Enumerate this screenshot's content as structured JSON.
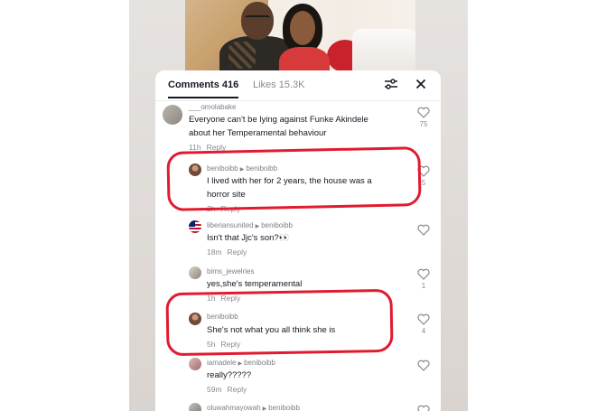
{
  "tabs": {
    "comments_label": "Comments 416",
    "likes_label": "Likes 15.3K"
  },
  "comments": [
    {
      "username": "___omolabake",
      "text_lines": [
        "Everyone can't be lying against Funke Akindele",
        "about her Temperamental behaviour"
      ],
      "time": "11h",
      "reply_label": "Reply",
      "likes": "75"
    },
    {
      "username": "beniboibb",
      "reply_to": "beniboibb",
      "text_lines": [
        "I lived with her for 2 years, the house was a",
        "horror site"
      ],
      "time": "2h",
      "reply_label": "Reply",
      "likes": "5"
    },
    {
      "username": "liberiansunited",
      "reply_to": "beniboibb",
      "text_lines": [
        "Isn't that Jjc's son?👀"
      ],
      "time": "18m",
      "reply_label": "Reply",
      "likes": ""
    },
    {
      "username": "bims_jewelries",
      "text_lines": [
        "yes,she's temperamental"
      ],
      "time": "1h",
      "reply_label": "Reply",
      "likes": "1"
    },
    {
      "username": "beniboibb",
      "text_lines": [
        "She's not what you all think she is"
      ],
      "time": "5h",
      "reply_label": "Reply",
      "likes": "4"
    },
    {
      "username": "iamadele",
      "reply_to": "beniboibb",
      "text_lines": [
        "really?????"
      ],
      "time": "59m",
      "reply_label": "Reply",
      "likes": ""
    },
    {
      "username": "oluwahmayowah",
      "reply_to": "beniboibb",
      "text_lines": [],
      "time": "",
      "reply_label": "",
      "likes": ""
    }
  ],
  "icons": {
    "filter": "sliders-icon",
    "close": "close-icon",
    "like": "heart-outline-icon"
  },
  "colors": {
    "annotation": "#e11b2f",
    "text_primary": "#161823",
    "text_secondary": "#8a8b91"
  }
}
